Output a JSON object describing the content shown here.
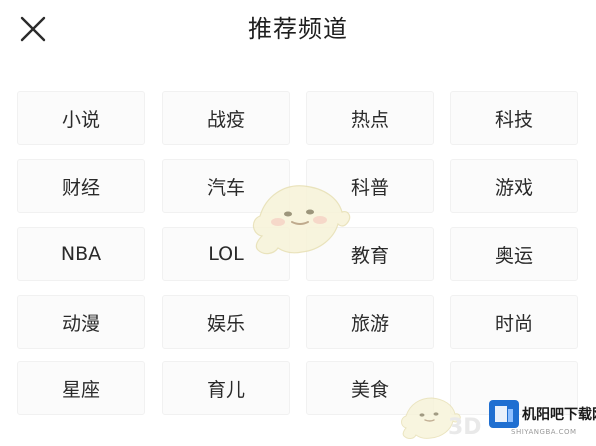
{
  "header": {
    "title": "推荐频道"
  },
  "channels": [
    {
      "label": "小说"
    },
    {
      "label": "战疫"
    },
    {
      "label": "热点"
    },
    {
      "label": "科技"
    },
    {
      "label": "财经"
    },
    {
      "label": "汽车"
    },
    {
      "label": "科普"
    },
    {
      "label": "游戏"
    },
    {
      "label": "NBA"
    },
    {
      "label": "LOL"
    },
    {
      "label": "教育"
    },
    {
      "label": "奥运"
    },
    {
      "label": "动漫"
    },
    {
      "label": "娱乐"
    },
    {
      "label": "旅游"
    },
    {
      "label": "时尚"
    },
    {
      "label": "星座"
    },
    {
      "label": "育儿"
    },
    {
      "label": "美食"
    },
    {
      "label": ""
    }
  ],
  "watermark": {
    "brand": "机阳吧下载网",
    "domain": "SHIYANGBA.COM",
    "mark_3d": "3D"
  },
  "colors": {
    "accent": "#1f6fd1",
    "chip_bg": "#fbfbfb",
    "text": "#2a2a2a"
  },
  "icons": {
    "close": "close-icon"
  }
}
